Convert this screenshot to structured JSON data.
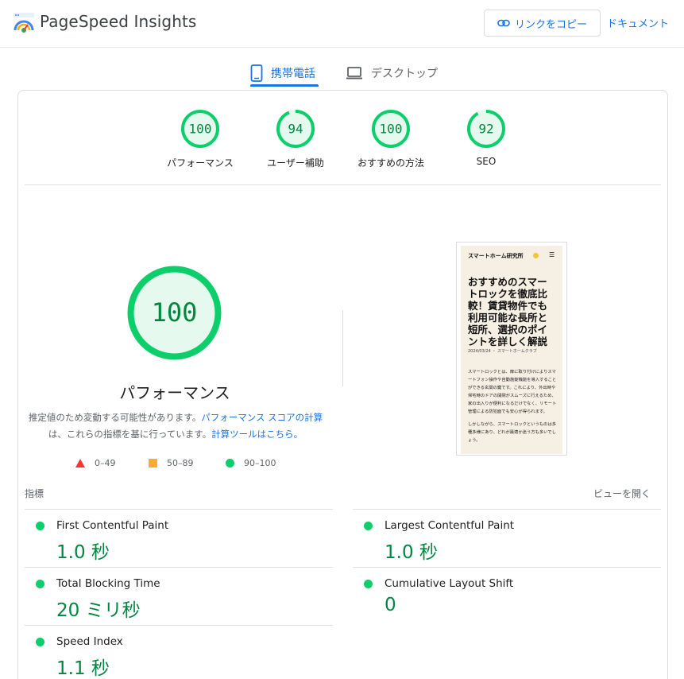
{
  "app": {
    "title": "PageSpeed Insights"
  },
  "header": {
    "copy_link": "リンクをコピー",
    "docs": "ドキュメント"
  },
  "tabs": [
    {
      "label": "携帯電話",
      "active": true
    },
    {
      "label": "デスクトップ",
      "active": false
    }
  ],
  "scores": [
    {
      "value": 100,
      "label": "パフォーマンス"
    },
    {
      "value": 94,
      "label": "ユーザー補助"
    },
    {
      "value": 100,
      "label": "おすすめの方法"
    },
    {
      "value": 92,
      "label": "SEO"
    }
  ],
  "performance": {
    "score": 100,
    "title": "パフォーマンス",
    "note_prefix": "推定値のため変動する可能性があります。",
    "note_link1": "パフォーマンス スコアの計算",
    "note_middle": "は、これらの指標を基に行っています。",
    "note_link2": "計算ツールはこちら。"
  },
  "legend": [
    {
      "range": "0–49",
      "shape": "triangle",
      "color": "#ff3333"
    },
    {
      "range": "50–89",
      "shape": "square",
      "color": "#ffaa33"
    },
    {
      "range": "90–100",
      "shape": "circle",
      "color": "#0cce6b"
    }
  ],
  "thumbnail": {
    "site_name": "スマートホーム研究所",
    "menu_icon": "hamburger-icon",
    "headline": "おすすめのスマートロックを徹底比較！賃貸物件でも利用可能な長所と短所、選択のポイントを詳しく解説",
    "date": "2024/03/24 ・ スマートホームクラブ",
    "body1": "スマートロックとは、扉に取り付けによりスマートフォン操作や自動施錠機能を導入することができる玄関の鍵です。これにより、外出時や帰宅時のドアの開閉がスムーズに行えるため、家の出入りが便利になるだけでなく、リモート管理による防犯面でも安心が得られます。",
    "body2": "しかしながら、スマートロックというものは多種多様にあり、どれが最適か迷う方も多いでしょう。"
  },
  "metrics_section": {
    "label": "指標",
    "expand": "ビューを開く"
  },
  "metrics": [
    {
      "name": "First Contentful Paint",
      "value": "1.0 秒",
      "status_color": "#0cce6b"
    },
    {
      "name": "Largest Contentful Paint",
      "value": "1.0 秒",
      "status_color": "#0cce6b"
    },
    {
      "name": "Total Blocking Time",
      "value": "20 ミリ秒",
      "status_color": "#0cce6b"
    },
    {
      "name": "Cumulative Layout Shift",
      "value": "0",
      "status_color": "#0cce6b"
    },
    {
      "name": "Speed Index",
      "value": "1.1 秒",
      "status_color": "#0cce6b"
    }
  ],
  "colors": {
    "accent": "#1a73e8",
    "pass": "#0cce6b",
    "pass_text": "#018642",
    "pass_fill": "#e6f9ee"
  }
}
